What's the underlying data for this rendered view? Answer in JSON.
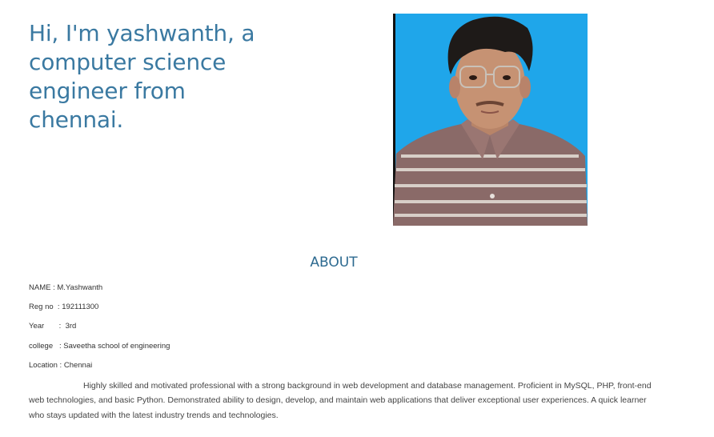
{
  "hero": {
    "greeting": "Hi, I'm yashwanth, a computer science engineer from chennai."
  },
  "profile_photo": {
    "background_color": "#1fa6ea"
  },
  "about": {
    "heading": "ABOUT",
    "name_row": "NAME : M.Yashwanth",
    "regno_row": "Reg no  : 192111300",
    "year_row": "Year       :  3rd",
    "college_row": "college   : Saveetha school of engineering",
    "location_row": "Location : Chennai",
    "bio": "Highly skilled and motivated professional with a strong background in web development and database management. Proficient in MySQL, PHP, front-end web technologies, and basic Python. Demonstrated ability to design, develop, and maintain web applications that deliver exceptional user experiences. A quick learner who stays updated with the latest industry trends and technologies."
  },
  "colors": {
    "accent": "#3a79a1",
    "heading": "#2d6a90",
    "text": "#333333"
  }
}
